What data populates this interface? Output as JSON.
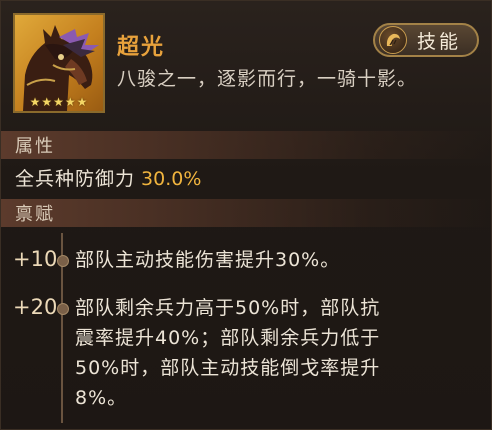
{
  "horse": {
    "name": "超光",
    "stars": "★★★★★",
    "star_count": 5,
    "description": "八骏之一，逐影而行，一骑十影。"
  },
  "skill_button": {
    "label": "技能",
    "icon": "horseshoe-wing-icon"
  },
  "attributes": {
    "header": "属性",
    "items": [
      {
        "label": "全兵种防御力",
        "value": "30.0%"
      }
    ]
  },
  "talents": {
    "header": "禀赋",
    "items": [
      {
        "level": "+10",
        "lines": [
          "部队主动技能伤害提升30%。"
        ]
      },
      {
        "level": "+20",
        "lines": [
          "部队剩余兵力高于50%时，部队抗",
          "震率提升40%；部队剩余兵力低于",
          "50%时，部队主动技能倒戈率提升",
          "8%。"
        ]
      }
    ]
  },
  "colors": {
    "name": "#e8a23c",
    "value_highlight": "#f0b43e",
    "header_bg": "#5c3b2c",
    "portrait_bg": "#c47f1e"
  }
}
